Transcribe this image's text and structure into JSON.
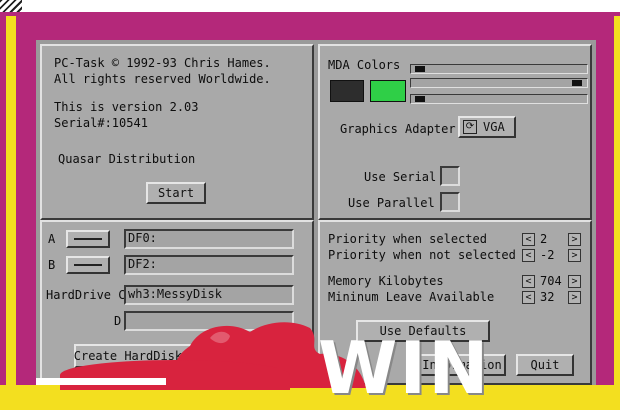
{
  "about": {
    "line1": "PC-Task © 1992-93 Chris Hames.",
    "line2": "All rights reserved Worldwide.",
    "version": "This is version 2.03",
    "serial": "Serial#:10541",
    "distributor": "Quasar Distribution",
    "start_label": "Start"
  },
  "display": {
    "colors_label": "MDA Colors",
    "color_bg": "#2d2d2d",
    "color_fg": "#2fcf47",
    "sliders": [
      0.02,
      0.99,
      0.02
    ],
    "graphics_label": "Graphics Adapter",
    "graphics_value": "VGA",
    "cycle_glyph": "⟳",
    "serial_label": "Use Serial",
    "parallel_label": "Use Parallel"
  },
  "drives": {
    "a_label": "A",
    "a_value": "DF0:",
    "b_label": "B",
    "b_value": "DF2:",
    "c_label": "HardDrive C",
    "c_value": "wh3:MessyDisk",
    "d_label": "D",
    "d_value": "",
    "create_label": "Create HardDisk File"
  },
  "priority": {
    "selected_label": "Priority when selected",
    "selected_value": "2",
    "notsel_label": "Priority when not selected",
    "notsel_value": "-2",
    "memory_label": "Memory Kilobytes",
    "memory_value": "704",
    "minleave_label": "Mininum Leave Available",
    "minleave_value": "32",
    "defaults_label": "Use Defaults",
    "info_label": "Information",
    "quit_label": "Quit",
    "left_glyph": "<",
    "right_glyph": ">"
  },
  "overlay": {
    "logo_text": "WIN"
  },
  "colors": {
    "background": "#f3df1f",
    "frame": "#b4287a",
    "splash": "#d8233e"
  }
}
